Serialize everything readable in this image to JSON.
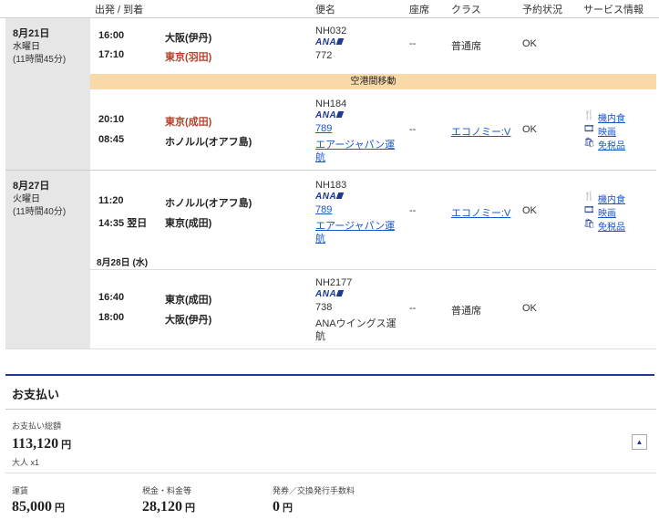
{
  "header": {
    "dep_arr": "出発 / 到着",
    "flight": "便名",
    "seat": "座席",
    "class": "クラス",
    "status": "予約状況",
    "service": "サービス情報"
  },
  "days": [
    {
      "date": "8月21日",
      "weekday": "水曜日",
      "duration": "(11時間45分)"
    },
    {
      "date": "8月27日",
      "weekday": "火曜日",
      "duration": "(11時間40分)"
    }
  ],
  "segments": [
    {
      "dep_time": "16:00",
      "dep_city": "大阪(伊丹)",
      "arr_time": "17:10",
      "arr_city": "東京(羽田)",
      "flight_no": "NH032",
      "airline_logo": "ANA",
      "aircraft": "772",
      "operator": "",
      "seat": "--",
      "class": "普通席",
      "status": "OK"
    },
    {
      "dep_time": "20:10",
      "dep_city": "東京(成田)",
      "arr_time": "08:45",
      "arr_city": "ホノルル(オアフ島)",
      "flight_no": "NH184",
      "airline_logo": "ANA",
      "aircraft": "789",
      "operator_line1": "エアージャパン運",
      "operator_line2": "航",
      "seat": "--",
      "class": "エコノミー:V",
      "status": "OK",
      "services": [
        "機内食",
        "映画",
        "免税品"
      ]
    },
    {
      "dep_time": "11:20",
      "dep_city": "ホノルル(オアフ島)",
      "arr_time": "14:35 翌日",
      "arr_city": "東京(成田)",
      "flight_no": "NH183",
      "airline_logo": "ANA",
      "aircraft": "789",
      "operator_line1": "エアージャパン運",
      "operator_line2": "航",
      "seat": "--",
      "class": "エコノミー:V",
      "status": "OK",
      "services": [
        "機内食",
        "映画",
        "免税品"
      ]
    },
    {
      "dep_time": "16:40",
      "dep_city": "東京(成田)",
      "arr_time": "18:00",
      "arr_city": "大阪(伊丹)",
      "flight_no": "NH2177",
      "airline_logo": "ANA",
      "aircraft": "738",
      "operator_line1": "ANAウイングス運",
      "operator_line2": "航",
      "seat": "--",
      "class": "普通席",
      "status": "OK"
    }
  ],
  "transfer_label": "空港間移動",
  "sub_date": "8月28日 (水)",
  "payment": {
    "title": "お支払い",
    "total_label": "お支払い総額",
    "total_value": "113,120",
    "yen": "円",
    "pax": "大人 x1",
    "fare_label": "運賃",
    "fare_value": "85,000",
    "tax_label": "税金・料金等",
    "tax_value": "28,120",
    "fee_label": "発券／交換発行手数料",
    "fee_value": "0",
    "toggle_icon": "caret-up-icon"
  },
  "colors": {
    "date_bg": "#e6e6e6",
    "transfer_bg": "#fad9a8",
    "red_city": "#b5402a",
    "link": "#1a57c9",
    "ana_blue": "#1d3a8f"
  }
}
